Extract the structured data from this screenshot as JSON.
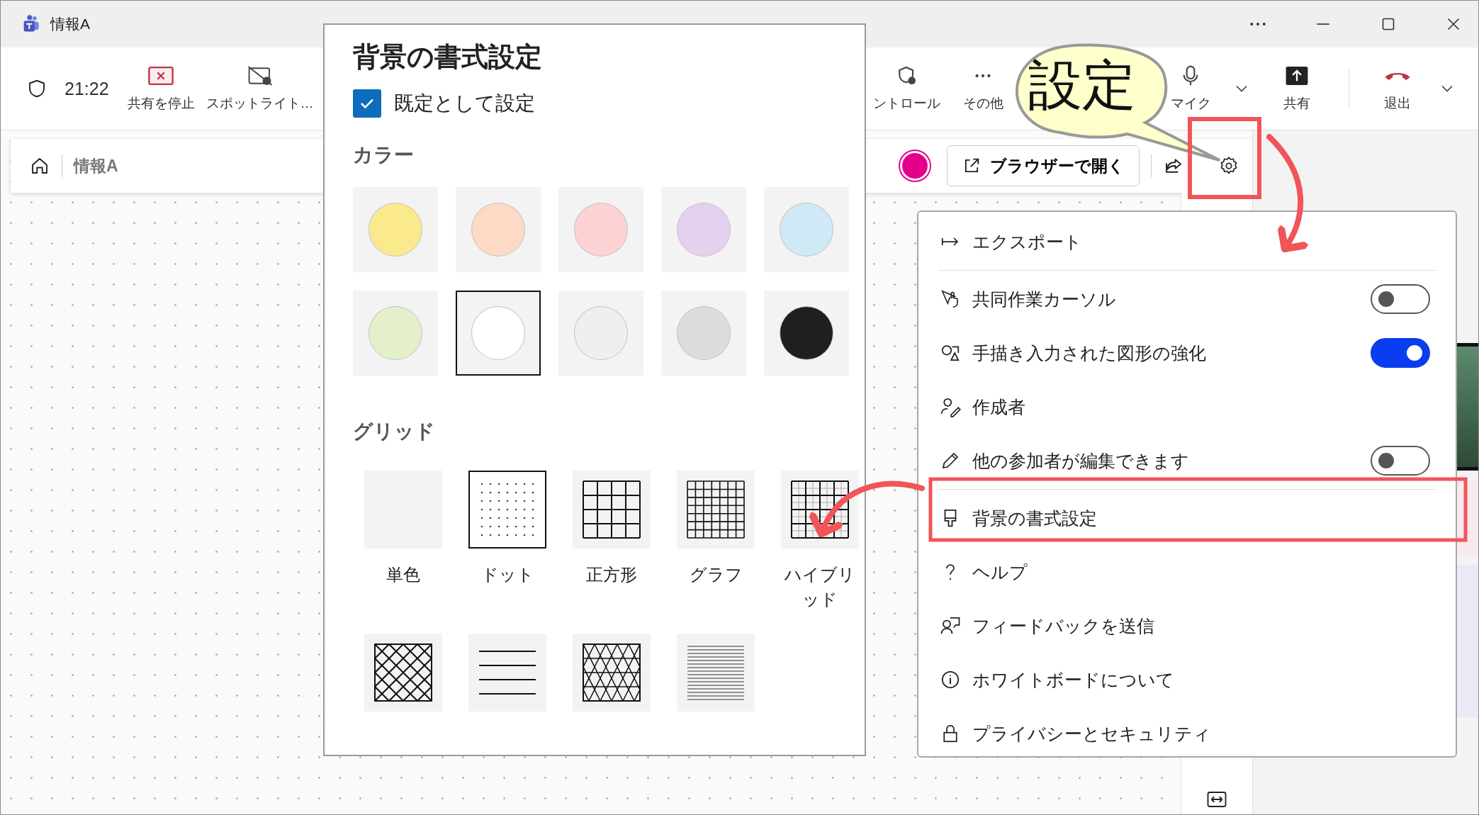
{
  "window": {
    "title": "情報A"
  },
  "toolbar": {
    "time": "21:22",
    "left_items": [
      {
        "kind": "stop-share",
        "label": "共有を停止"
      },
      {
        "kind": "spotlight",
        "label": "スポットライト…"
      }
    ],
    "right_items": [
      {
        "kind": "control",
        "label": "ントロール"
      },
      {
        "kind": "more",
        "label": "その他"
      },
      {
        "kind": "mic",
        "label": "マイク"
      },
      {
        "kind": "share",
        "label": "共有"
      },
      {
        "kind": "leave",
        "label": "退出"
      }
    ]
  },
  "header": {
    "breadcrumb": "情報A",
    "open_button": "ブラウザーで開く"
  },
  "format_panel": {
    "title": "背景の書式設定",
    "default_checkbox": {
      "label": "既定として設定",
      "checked": true
    },
    "color_heading": "カラー",
    "colors": [
      {
        "color": "#fbe98e",
        "selected": false
      },
      {
        "color": "#fcdac6",
        "selected": false
      },
      {
        "color": "#fdd2d4",
        "selected": false
      },
      {
        "color": "#e3d1ef",
        "selected": false
      },
      {
        "color": "#cfe9f6",
        "selected": false
      },
      {
        "color": "#e3f0cb",
        "selected": false
      },
      {
        "color": "#ffffff",
        "selected": true
      },
      {
        "color": "#efefef",
        "selected": false
      },
      {
        "color": "#dcdcdc",
        "selected": false
      },
      {
        "color": "#1f1f1f",
        "selected": false
      }
    ],
    "grid_heading": "グリッド",
    "grids": [
      {
        "kind": "solid",
        "label": "単色",
        "selected": false
      },
      {
        "kind": "dots",
        "label": "ドット",
        "selected": true
      },
      {
        "kind": "squares",
        "label": "正方形",
        "selected": false
      },
      {
        "kind": "graph",
        "label": "グラフ",
        "selected": false
      },
      {
        "kind": "hybrid",
        "label": "ハイブリッド",
        "selected": false
      },
      {
        "kind": "diamond",
        "selected": false
      },
      {
        "kind": "lines",
        "selected": false
      },
      {
        "kind": "triangles",
        "selected": false
      },
      {
        "kind": "fine-lines",
        "selected": false
      }
    ]
  },
  "menu": {
    "groups": [
      [
        {
          "kind": "export",
          "label": "エクスポート"
        }
      ],
      [
        {
          "kind": "cursor",
          "label": "共同作業カーソル",
          "on": false
        },
        {
          "kind": "shapes",
          "label": "手描き入力された図形の強化",
          "on": true
        },
        {
          "kind": "author",
          "label": "作成者"
        },
        {
          "kind": "edit",
          "label": "他の参加者が編集できます",
          "on": false
        }
      ],
      [
        {
          "kind": "format",
          "label": "背景の書式設定"
        },
        {
          "kind": "help",
          "label": "ヘルプ"
        },
        {
          "kind": "feedback",
          "label": "フィードバックを送信"
        },
        {
          "kind": "about",
          "label": "ホワイトボードについて"
        },
        {
          "kind": "privacy",
          "label": "プライバシーとセキュリティ"
        }
      ]
    ]
  },
  "annotation": {
    "callout": "設定"
  }
}
